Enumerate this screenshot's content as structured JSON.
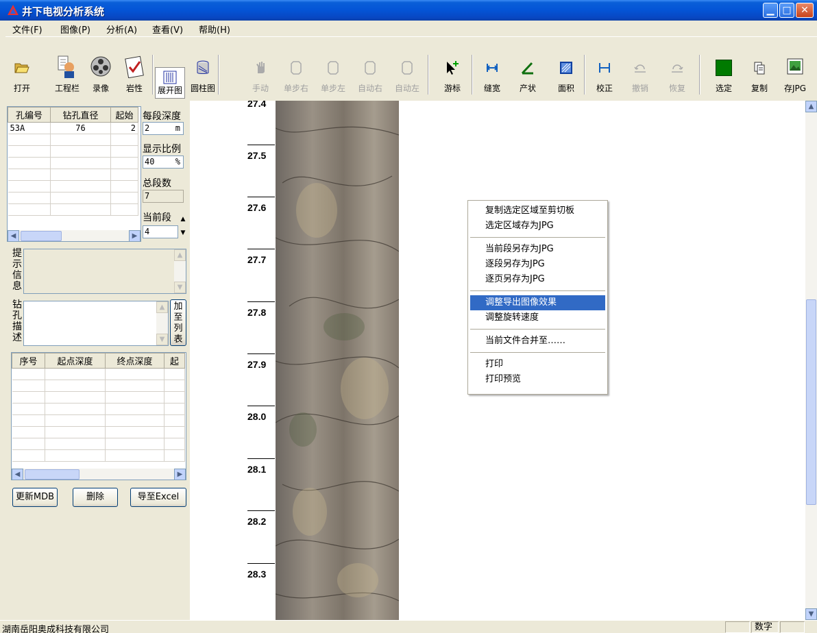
{
  "window": {
    "title": "井下电视分析系统"
  },
  "menu": [
    "文件(F)",
    "图像(P)",
    "分析(A)",
    "查看(V)",
    "帮助(H)"
  ],
  "toolbar": {
    "open": "打开",
    "project": "工程栏",
    "record": "录像",
    "lithology": "岩性",
    "unfold": "展开图",
    "cylinder": "圆柱图",
    "manual": "手动",
    "step_right": "单步右",
    "step_left": "单步左",
    "auto_right": "自动右",
    "auto_left": "自动左",
    "cursor": "游标",
    "gap_width": "缝宽",
    "attitude": "产状",
    "area": "面积",
    "calibrate": "校正",
    "undo": "撤销",
    "redo": "恢复",
    "select": "选定",
    "copy": "复制",
    "save_jpg": "存JPG"
  },
  "colors": {
    "select_square": "#007a00",
    "menu_highlight": "#316ac5",
    "titlebar": "#0454d6"
  },
  "hole_table": {
    "headers": [
      "孔编号",
      "钻孔直径",
      "起始"
    ],
    "rows": [
      [
        "53A",
        "76",
        "2"
      ]
    ]
  },
  "params": {
    "depth_per_segment_label": "每段深度",
    "depth_per_segment": "2",
    "depth_unit": "m",
    "display_ratio_label": "显示比例",
    "display_ratio": "40",
    "ratio_unit": "%",
    "total_segments_label": "总段数",
    "total_segments": "7",
    "current_segment_label": "当前段",
    "current_segment": "4"
  },
  "hint_label": "提示信息",
  "hole_desc_label": "钻孔描述",
  "add_to_list": "加至列表",
  "segment_table": {
    "headers": [
      "序号",
      "起点深度",
      "终点深度",
      "起"
    ]
  },
  "buttons": {
    "update_mdb": "更新MDB",
    "delete": "删除",
    "export_excel": "导至Excel"
  },
  "depth_labels": [
    "27.4",
    "27.5",
    "27.6",
    "27.7",
    "27.8",
    "27.9",
    "28.0",
    "28.1",
    "28.2",
    "28.3"
  ],
  "context_menu": {
    "items": [
      "复制选定区域至剪切板",
      "选定区域存为JPG",
      "当前段另存为JPG",
      "逐段另存为JPG",
      "逐页另存为JPG",
      "调整导出图像效果",
      "调整旋转速度",
      "当前文件合并至……",
      "打印",
      "打印预览"
    ],
    "highlighted": "调整导出图像效果"
  },
  "status": {
    "company": "湖南岳阳奥成科技有限公司",
    "mode": "数字"
  }
}
